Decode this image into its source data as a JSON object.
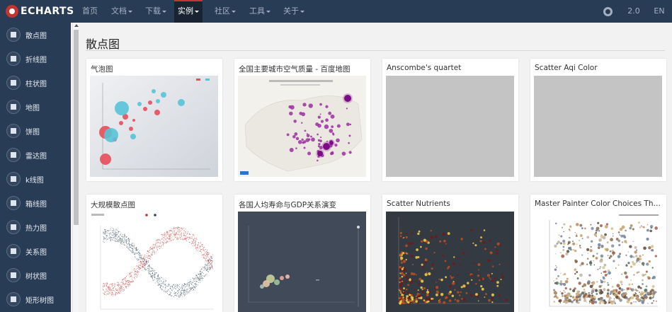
{
  "brand": {
    "name": "ECHARTS"
  },
  "nav": [
    {
      "label": "首页",
      "caret": false
    },
    {
      "label": "文档",
      "caret": true
    },
    {
      "label": "下载",
      "caret": true
    },
    {
      "label": "实例",
      "caret": true,
      "active": true
    },
    {
      "label": "社区",
      "caret": true
    },
    {
      "label": "工具",
      "caret": true
    },
    {
      "label": "关于",
      "caret": true
    }
  ],
  "nav_right": {
    "github_icon": "github-icon",
    "version": "2.0",
    "language": "EN"
  },
  "sidebar": [
    {
      "label": "散点图",
      "icon": "scatter-icon"
    },
    {
      "label": "折线图",
      "icon": "line-icon"
    },
    {
      "label": "柱状图",
      "icon": "bar-icon"
    },
    {
      "label": "地图",
      "icon": "map-icon"
    },
    {
      "label": "饼图",
      "icon": "pie-icon"
    },
    {
      "label": "雷达图",
      "icon": "radar-icon"
    },
    {
      "label": "k线图",
      "icon": "candlestick-icon"
    },
    {
      "label": "箱线图",
      "icon": "boxplot-icon"
    },
    {
      "label": "热力图",
      "icon": "heatmap-icon"
    },
    {
      "label": "关系图",
      "icon": "graph-icon"
    },
    {
      "label": "树状图",
      "icon": "tree-icon"
    },
    {
      "label": "矩形树图",
      "icon": "treemap-icon"
    }
  ],
  "page": {
    "title": "散点图"
  },
  "cards": [
    {
      "title": "气泡图",
      "preview": "bubble"
    },
    {
      "title": "全国主要城市空气质量 - 百度地图",
      "preview": "baidu-map"
    },
    {
      "title": "Anscombe's quartet",
      "preview": "gray"
    },
    {
      "title": "Scatter Aqi Color",
      "preview": "gray"
    },
    {
      "title": "大规模散点图",
      "preview": "large-scatter"
    },
    {
      "title": "各国人均寿命与GDP关系演变",
      "preview": "life-gdp"
    },
    {
      "title": "Scatter Nutrients",
      "preview": "nutrients"
    },
    {
      "title": "Master Painter Color Choices Through...",
      "preview": "painter"
    }
  ],
  "colors": {
    "nav_bg": "#293c55",
    "active_nav_bg": "#1a2331",
    "accent": "#c23531",
    "bubble_red": "#e84d5a",
    "bubble_cyan": "#55c3d8"
  }
}
